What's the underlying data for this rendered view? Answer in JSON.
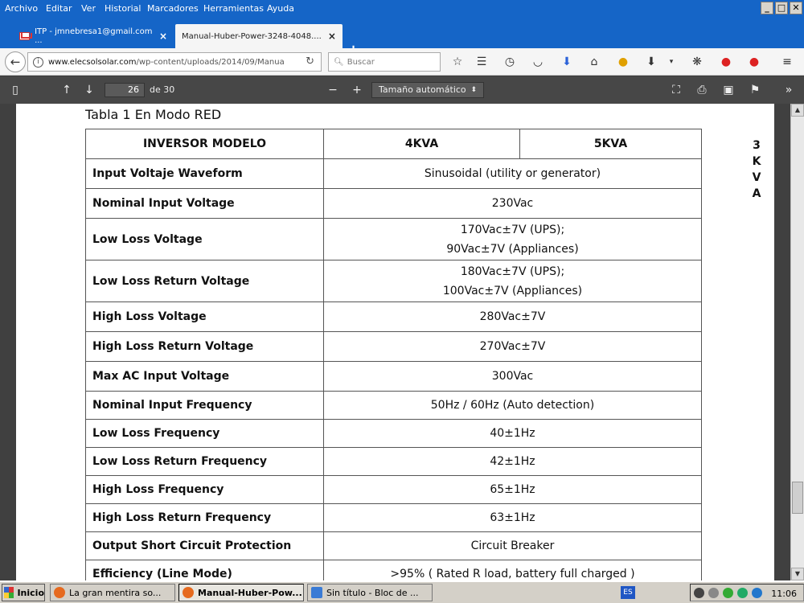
{
  "menubar": {
    "items": [
      "Archivo",
      "Editar",
      "Ver",
      "Historial",
      "Marcadores",
      "Herramientas",
      "Ayuda"
    ]
  },
  "tabs": [
    {
      "label": "ITP - jmnebresa1@gmail.com ...",
      "icon": "gmail-icon"
    },
    {
      "label": "Manual-Huber-Power-3248-4048....",
      "icon": "pdf-icon"
    }
  ],
  "navbar": {
    "url_domain": "www.elecsolsolar.com",
    "url_path": "/wp-content/uploads/2014/09/Manua",
    "search_placeholder": "Buscar"
  },
  "pdf_toolbar": {
    "page_number": "26",
    "page_count_text": "de 30",
    "zoom_label": "Tamaño automático"
  },
  "document": {
    "caption": "Tabla 1 En Modo RED",
    "table": {
      "headers": [
        "INVERSOR MODELO",
        "4KVA",
        "5KVA"
      ],
      "rows": [
        {
          "label": "Input Voltaje Waveform",
          "value": [
            "Sinusoidal (utility or generator)"
          ]
        },
        {
          "label": "Nominal Input Voltage",
          "value": [
            "230Vac"
          ]
        },
        {
          "label": "Low Loss Voltage",
          "value": [
            "170Vac±7V (UPS);",
            "90Vac±7V (Appliances)"
          ]
        },
        {
          "label": "Low Loss Return Voltage",
          "value": [
            "180Vac±7V (UPS);",
            "100Vac±7V (Appliances)"
          ]
        },
        {
          "label": "High Loss Voltage",
          "value": [
            "280Vac±7V"
          ]
        },
        {
          "label": "High Loss Return Voltage",
          "value": [
            "270Vac±7V"
          ]
        },
        {
          "label": "Max AC Input Voltage",
          "value": [
            "300Vac"
          ]
        },
        {
          "label": "Nominal Input Frequency",
          "value": [
            "50Hz / 60Hz (Auto detection)"
          ]
        },
        {
          "label": "Low Loss Frequency",
          "value": [
            "40±1Hz"
          ]
        },
        {
          "label": "Low Loss Return Frequency",
          "value": [
            "42±1Hz"
          ]
        },
        {
          "label": "High Loss Frequency",
          "value": [
            "65±1Hz"
          ]
        },
        {
          "label": "High Loss Return Frequency",
          "value": [
            "63±1Hz"
          ]
        },
        {
          "label": "Output Short Circuit Protection",
          "value": [
            "Circuit Breaker"
          ]
        },
        {
          "label": "Efficiency (Line Mode)",
          "value": [
            ">95% ( Rated R load, battery full charged )"
          ]
        }
      ]
    },
    "side_letters": [
      "3",
      "K",
      "V",
      "A"
    ]
  },
  "taskbar": {
    "start_label": "Inicio",
    "tasks": [
      {
        "label": "La gran mentira so...",
        "icon_color": "#e66a1f"
      },
      {
        "label": "Manual-Huber-Pow...",
        "icon_color": "#e66a1f"
      },
      {
        "label": "Sin título - Bloc de ...",
        "icon_color": "#3a7bd5"
      }
    ],
    "language": "ES",
    "clock": "11:06"
  },
  "colors": {
    "titlebar": "#1565c7",
    "pdf_toolbar": "#474747",
    "taskbar": "#d4d0c8"
  }
}
